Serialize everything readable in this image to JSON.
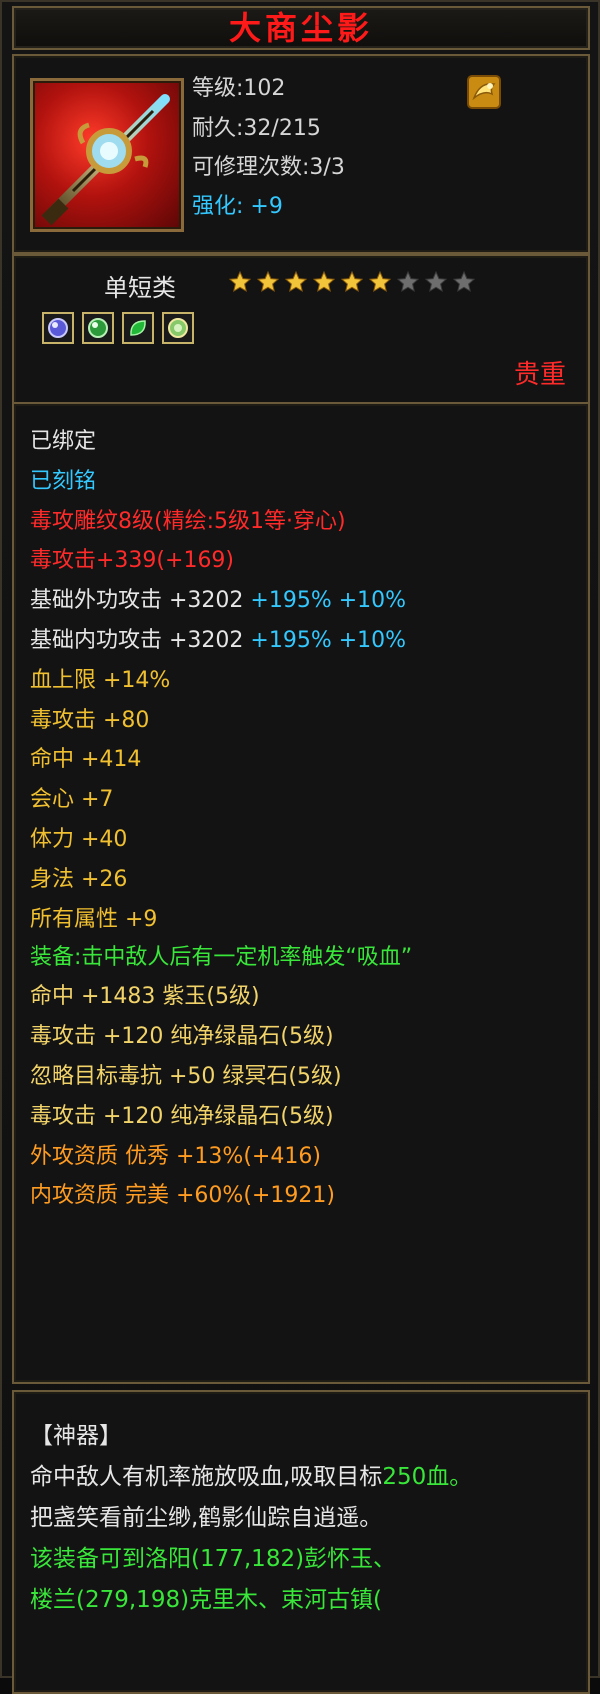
{
  "title": "大商尘影",
  "header": {
    "level_label": "等级",
    "level_value": ":102",
    "durability_label": "耐久",
    "durability_value": ":32/215",
    "repair_label": "可修理次数",
    "repair_value": ":3/3",
    "enhance_label": "强化:",
    "enhance_value": "+9",
    "icon": "sword-icon",
    "scroll_icon": "scroll-icon"
  },
  "type": {
    "label": "单短类",
    "stars_total": 9,
    "stars_filled": 6,
    "gems": [
      "purple-gem-icon",
      "green-gem-icon",
      "green-leaf-gem-icon",
      "jade-gem-icon"
    ],
    "rarity": "贵重"
  },
  "attributes": [
    {
      "text": "已绑定",
      "color": "#e6e6e6"
    },
    {
      "text": "已刻铭",
      "color": "#33c8ff"
    },
    {
      "text": "毒攻雕纹8级(精绘:5级1等·穿心)",
      "color": "#ff2a2a"
    },
    {
      "text": "毒攻击+339(+169)",
      "color": "#ff2a2a"
    },
    {
      "label": "基础外功攻击 +3202",
      "extra": "+195% +10%"
    },
    {
      "label": "基础内功攻击 +3202",
      "extra": "+195% +10%"
    },
    {
      "text": "血上限 +14%",
      "color": "#f0c030"
    },
    {
      "text": "毒攻击 +80",
      "color": "#f0c030"
    },
    {
      "text": "命中 +414",
      "color": "#f0c030"
    },
    {
      "text": "会心 +7",
      "color": "#f0c030"
    },
    {
      "text": "体力 +40",
      "color": "#f0c030"
    },
    {
      "text": "身法 +26",
      "color": "#f0c030"
    },
    {
      "text": "所有属性 +9",
      "color": "#f0c030"
    },
    {
      "text": "装备:击中敌人后有一定机率触发“吸血”",
      "color": "#39e63a",
      "wrap": true
    },
    {
      "text": "命中 +1483 紫玉(5级)",
      "color": "#f1d36a"
    },
    {
      "text": "毒攻击 +120 纯净绿晶石(5级)",
      "color": "#f1d36a"
    },
    {
      "text": "忽略目标毒抗 +50 绿冥石(5级)",
      "color": "#f1d36a"
    },
    {
      "text": "毒攻击 +120 纯净绿晶石(5级)",
      "color": "#f1d36a"
    },
    {
      "text": "外攻资质   优秀 +13%(+416)",
      "color": "#ff9c21"
    },
    {
      "text": "内攻资质   完美 +60%(+1921)",
      "color": "#ff9c21"
    }
  ],
  "description": {
    "heading": "【神器】",
    "line1_main": "命中敌人有机率施放吸血,吸取目标",
    "line1_highlight": "250血。",
    "line2": "把盏笑看前尘缈,鹤影仙踪自逍遥。",
    "line3": "该装备可到洛阳(177,182)彭怀玉、",
    "line4": "楼兰(279,198)克里木、束河古镇("
  }
}
